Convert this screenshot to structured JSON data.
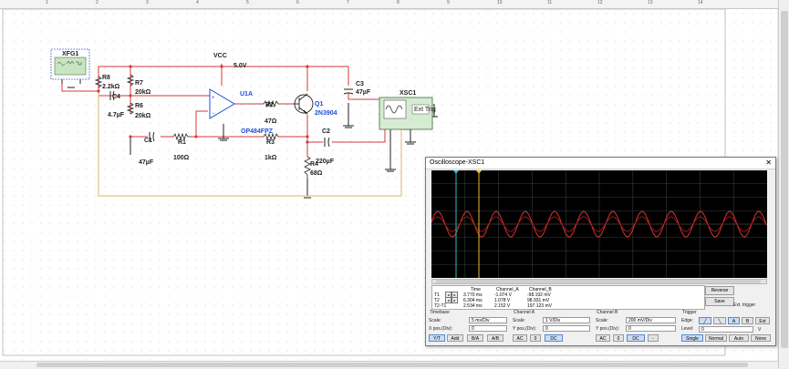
{
  "ruler": {
    "marks": [
      "1",
      "2",
      "3",
      "4",
      "5",
      "6",
      "7",
      "8",
      "9",
      "10",
      "11",
      "12",
      "13",
      "14"
    ]
  },
  "schematic": {
    "vcc_label": "VCC",
    "vcc_value": "5.0V",
    "xfg_label": "XFG1",
    "xsc_label": "XSC1",
    "xsc_ext_trig": "Ext Trig",
    "opamp_name": "U1A",
    "opamp_part": "OP484FPZ",
    "transistor_name": "Q1",
    "transistor_part": "2N3904",
    "r8": {
      "name": "R8",
      "value": "2.2kΩ"
    },
    "r7": {
      "name": "R7",
      "value": "20kΩ"
    },
    "r6": {
      "name": "R6",
      "value": "20kΩ"
    },
    "r2": {
      "name": "R2",
      "value": "47Ω"
    },
    "r1": {
      "name": "R1",
      "value": "100Ω"
    },
    "r3": {
      "name": "R3",
      "value": "1kΩ"
    },
    "r4": {
      "name": "R4",
      "value": "68Ω"
    },
    "c4": {
      "name": "C4",
      "value": "4.7µF"
    },
    "c1": {
      "name": "C1",
      "value": "47µF"
    },
    "c2": {
      "name": "C2",
      "value": "220µF"
    },
    "c3": {
      "name": "C3",
      "value": "47µF"
    },
    "colors": {
      "wire": "#d43a3a",
      "wire_ground": "#222222",
      "wire_probe": "#d9b46a",
      "part_blue": "#1e4fd6"
    }
  },
  "oscilloscope": {
    "title": "Oscilloscope-XSC1",
    "close_icon": "✕",
    "readout": {
      "headers": [
        "Time",
        "Channel_A",
        "Channel_B"
      ],
      "rows": [
        {
          "label": "T1",
          "time": "3.770 ms",
          "a": "-1.074 V",
          "b": "-98.192 mV"
        },
        {
          "label": "T2",
          "time": "6.304 ms",
          "a": "1.078 V",
          "b": "98.931 mV"
        },
        {
          "label": "T2-T1",
          "time": "2.534 ms",
          "a": "2.152 V",
          "b": "197.123 mV"
        }
      ]
    },
    "buttons": {
      "reverse": "Reverse",
      "save": "Save",
      "ext_trigger": "Ext. trigger"
    },
    "timebase": {
      "title": "Timebase",
      "scale_label": "Scale:",
      "scale": "5 ms/Div",
      "xpos_label": "X pos.(Div):",
      "xpos": "0",
      "modes": [
        "Y/T",
        "Add",
        "B/A",
        "A/B"
      ]
    },
    "channel_a": {
      "title": "Channel A",
      "scale_label": "Scale:",
      "scale": "1 V/Div",
      "ypos_label": "Y pos.(Div):",
      "ypos": "0",
      "coupling": [
        "AC",
        "0",
        "DC"
      ]
    },
    "channel_b": {
      "title": "Channel B",
      "scale_label": "Scale:",
      "scale": "200 mV/Div",
      "ypos_label": "Y pos.(Div):",
      "ypos": "0",
      "coupling": [
        "AC",
        "0",
        "DC",
        "-"
      ]
    },
    "trigger": {
      "title": "Trigger",
      "edge_label": "Edge:",
      "level_label": "Level:",
      "level": "0",
      "level_unit": "V",
      "sources": [
        "A",
        "B",
        "Ext"
      ],
      "modes": [
        "Single",
        "Normal",
        "Auto",
        "None"
      ]
    },
    "colors": {
      "screen": "#000000",
      "grid": "#3a3a3a",
      "trace_a": "#e23b3b",
      "trace_b": "#b01616",
      "cursor1": "#2fb9c9",
      "cursor2": "#e7c12f"
    }
  }
}
